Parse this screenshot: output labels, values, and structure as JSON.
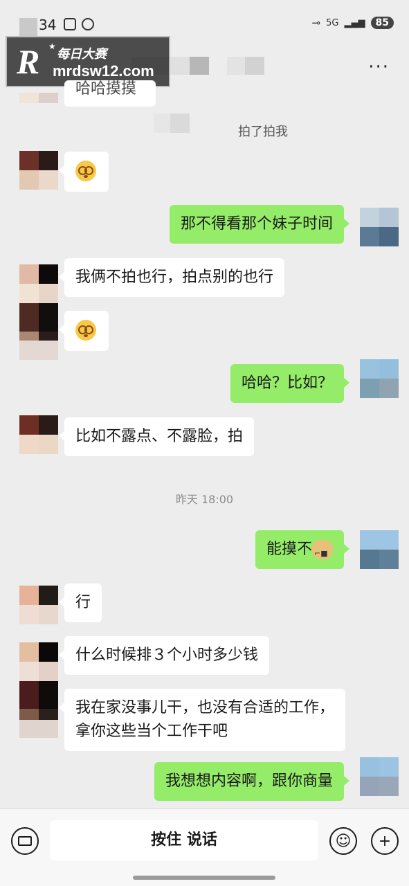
{
  "status": {
    "time": "34",
    "network": "5G",
    "battery": "85"
  },
  "header": {
    "more_label": "···"
  },
  "watermark": {
    "brand_cn": "每日大赛",
    "url": "mrdsw12.com",
    "letter": "R"
  },
  "messages": [
    {
      "side": "in",
      "text": "哈哈摸摸"
    },
    {
      "side": "system",
      "text": "拍了拍我"
    },
    {
      "side": "in",
      "text": ""
    },
    {
      "side": "out",
      "text": "那不得看那个妹子时间"
    },
    {
      "side": "in",
      "text": "我俩不拍也行，拍点别的也行"
    },
    {
      "side": "in",
      "text": ""
    },
    {
      "side": "out",
      "text": "哈哈？比如？"
    },
    {
      "side": "in",
      "text": "比如不露点、不露脸，拍"
    },
    {
      "side": "time",
      "text": "昨天 18:00"
    },
    {
      "side": "out",
      "text": "能摸不"
    },
    {
      "side": "in",
      "text": "行"
    },
    {
      "side": "in",
      "text": "什么时候排３个小时多少钱"
    },
    {
      "side": "in",
      "text": "我在家没事儿干，也没有合适的工作，拿你这些当个工作干吧"
    },
    {
      "side": "out",
      "text": "我想想内容啊，跟你商量"
    }
  ],
  "input": {
    "voice_label": "按住 说话"
  },
  "colors": {
    "out_bubble": "#95ec69",
    "in_bubble": "#ffffff",
    "background": "#ededed"
  }
}
